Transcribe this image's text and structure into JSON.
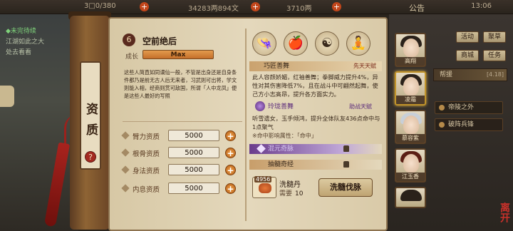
{
  "topbar": {
    "stamina": "3□0/380",
    "silver": "34283两894文",
    "gold": "3710两",
    "notice": "公告",
    "time": "13:06"
  },
  "quest": {
    "title": "◆未完待续",
    "line1": "江湖如此之大",
    "line2": "处去看看"
  },
  "panel": {
    "category_label": "资质",
    "help_icon": "?",
    "fortune_icon": "6",
    "fate_title": "空前绝后",
    "growth_label": "成长",
    "growth_value": "Max",
    "lore": "这些人简直如同谪仙一般，不管是出身还是自身条件都乃是前无古人后无来者，习武则可出将，学文则能入相，经商则赏可敌国，所谓「人中龙凤」便是这些人最好的写照",
    "stats": [
      {
        "label": "臂力资质",
        "value": "5000",
        "plus": "+"
      },
      {
        "label": "根骨资质",
        "value": "5000",
        "plus": "+"
      },
      {
        "label": "身法资质",
        "value": "5000",
        "plus": "+"
      },
      {
        "label": "内息资质",
        "value": "5000",
        "plus": "+"
      }
    ]
  },
  "skills": {
    "icons": [
      "scholar-hat-icon",
      "fruit-basket-icon",
      "yin-yang-icon",
      "bodhisattva-icon"
    ],
    "icon_glyphs": [
      "👒",
      "🍎",
      "☯",
      "🧘"
    ],
    "skill1_name": "巧匠善舞",
    "skill1_tag": "先天天赋",
    "skill1_desc": "此人容颜娇媚，红袖善舞；拳脚威力提升4%，异性对其伤害降低7%，且在战斗中可翩然起舞，使己方小志高昂，提升各方面实力。",
    "skill2_name": "玲珑善舞",
    "skill2_tag": "助战天赋",
    "skill2_desc": "听雪遗女，玉手倾鸿，提升全体队友436点命中与1点聚气",
    "skill2_note": "※命中影响属性：「命中」",
    "skill3_name": "混元奇脉",
    "skill4_name": "抽髓奇经"
  },
  "item": {
    "qty": "4956",
    "name": "洗髓丹",
    "need_label": "需要",
    "need_value": "10",
    "button": "洗髓伐脉"
  },
  "right": {
    "characters": [
      "高翔",
      "凌霜",
      "慕容紫",
      "江玉香"
    ],
    "menu": [
      "活动",
      "聚草",
      "商城",
      "任务"
    ],
    "strip_label": "帮援",
    "strip_value": "[4.18]",
    "options": [
      "帝陵之外",
      "破阵兵锋"
    ],
    "leave": "离开"
  }
}
